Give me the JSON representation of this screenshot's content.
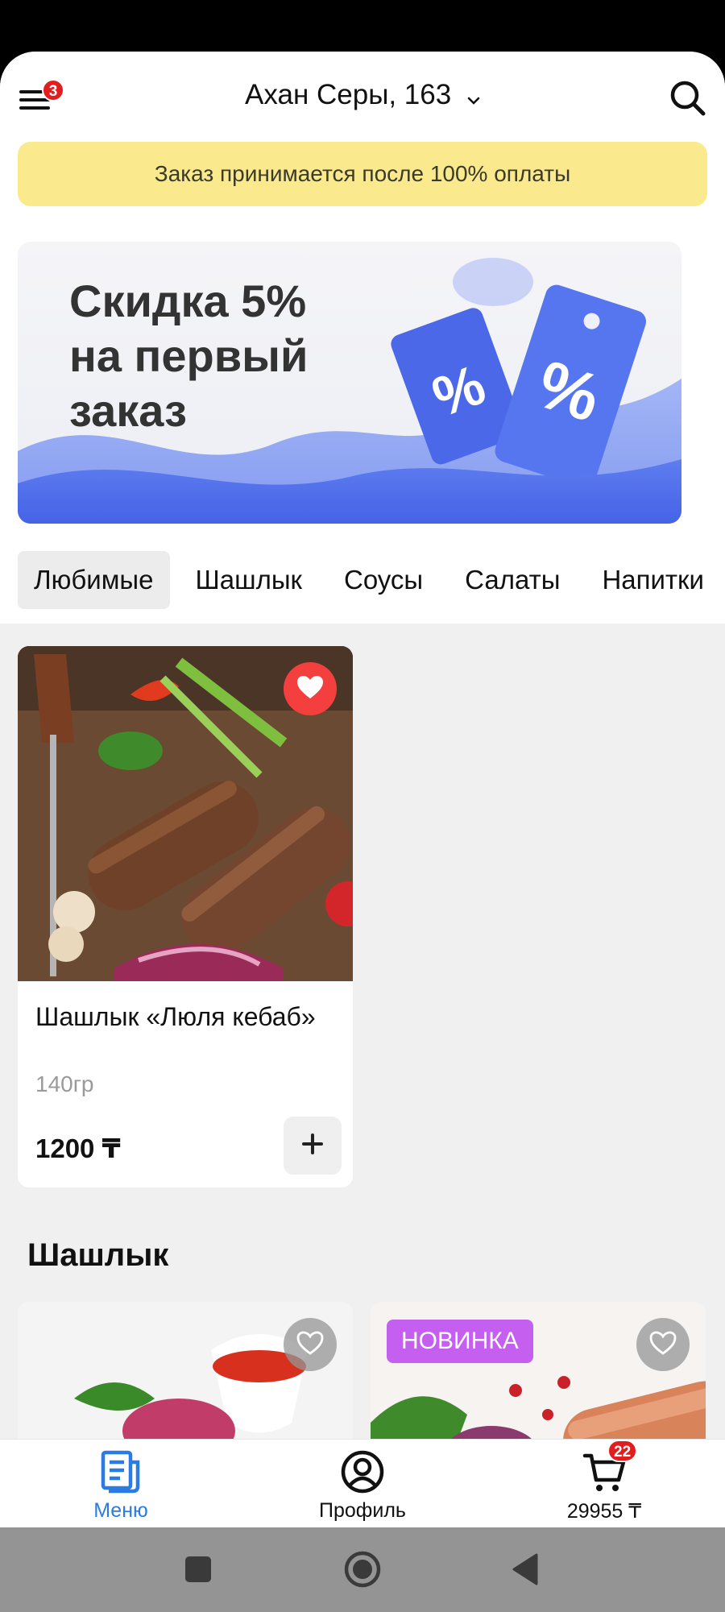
{
  "header": {
    "menu_badge": "3",
    "address": "Ахан Серы, 163"
  },
  "notice": "Заказ принимается после 100% оплаты",
  "banner": {
    "text": "Скидка 5%\nна первый\nзаказ"
  },
  "tabs": [
    {
      "label": "Любимые",
      "active": true
    },
    {
      "label": "Шашлык",
      "active": false
    },
    {
      "label": "Соусы",
      "active": false
    },
    {
      "label": "Салаты",
      "active": false
    },
    {
      "label": "Напитки",
      "active": false
    }
  ],
  "favorites": [
    {
      "title": "Шашлык «Люля кебаб»",
      "weight": "140гр",
      "price": "1200 ₸",
      "favorited": true
    }
  ],
  "section": {
    "title": "Шашлык",
    "cards": [
      {
        "badge": "",
        "favorited": false
      },
      {
        "badge": "НОВИНКА",
        "favorited": false
      }
    ]
  },
  "bottom_nav": {
    "menu_label": "Меню",
    "profile_label": "Профиль",
    "cart_total": "29955 ₸",
    "cart_badge": "22"
  },
  "colors": {
    "accent": "#2a7be4",
    "notice_bg": "#fbe98e",
    "badge_red": "#e11d1d",
    "favorite_red": "#f43f3f",
    "new_badge": "#c45ff0"
  },
  "icons": [
    "menu-icon",
    "chevron-down-icon",
    "search-icon",
    "heart-icon",
    "plus-icon",
    "menu-doc-icon",
    "profile-icon",
    "cart-icon",
    "recents-icon",
    "home-icon",
    "back-icon"
  ]
}
